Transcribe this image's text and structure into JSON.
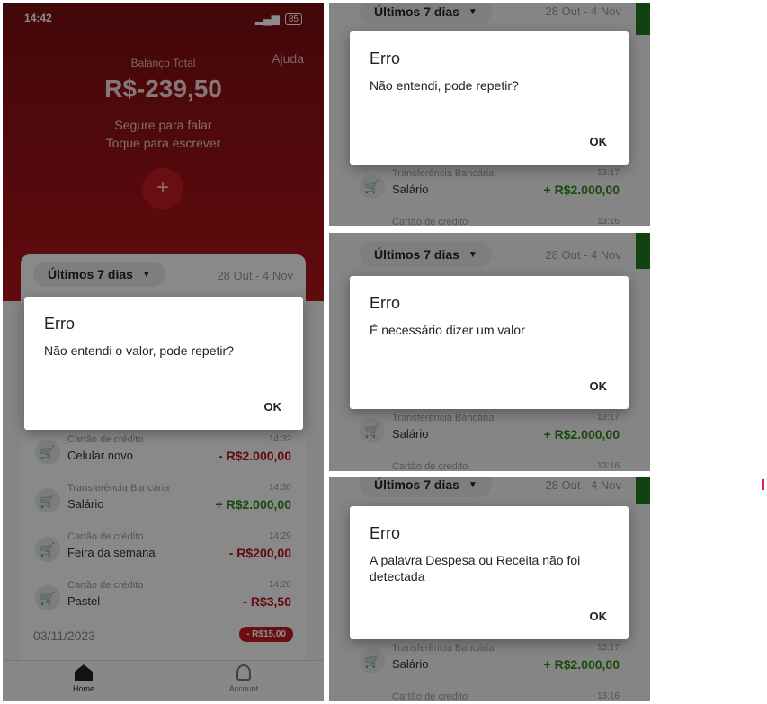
{
  "main": {
    "status_time": "14:42",
    "status_right": "85",
    "help": "Ajuda",
    "balance_label": "Balanço Total",
    "balance_value": "R$-239,50",
    "hint_line1": "Segure para falar",
    "hint_line2": "Toque para escrever",
    "add_symbol": "+",
    "period": "Últimos 7 dias",
    "date_range": "28 Out - 4 Nov",
    "dialog": {
      "title": "Erro",
      "message": "Não entendi o valor, pode repetir?",
      "ok": "OK"
    },
    "transactions": [
      {
        "sub": "Cartão de crédito",
        "name": "Celular novo",
        "time": "14:32",
        "value": "- R$2.000,00",
        "kind": "neg"
      },
      {
        "sub": "Transferência Bancária",
        "name": "Salário",
        "time": "14:30",
        "value": "+ R$2.000,00",
        "kind": "pos"
      },
      {
        "sub": "Cartão de crédito",
        "name": "Feira da semana",
        "time": "14:29",
        "value": "- R$200,00",
        "kind": "neg"
      },
      {
        "sub": "Cartão de crédito",
        "name": "Pastel",
        "time": "14:28",
        "value": "- R$3,50",
        "kind": "neg"
      }
    ],
    "day_date": "03/11/2023",
    "day_total": "- R$15,00",
    "nav": {
      "home": "Home",
      "account": "Account"
    }
  },
  "panels": [
    {
      "period": "Últimos 7 dias",
      "date_range": "28 Out - 4 Nov",
      "dialog": {
        "title": "Erro",
        "message": "Não entendi, pode repetir?",
        "ok": "OK"
      },
      "tx1": {
        "sub": "Transferência Bancária",
        "name": "Salário",
        "time": "13:17",
        "value": "+ R$2.000,00"
      },
      "tx2": {
        "sub": "Cartão de crédito",
        "time": "13:16"
      }
    },
    {
      "period": "Últimos 7 dias",
      "date_range": "28 Out - 4 Nov",
      "dialog": {
        "title": "Erro",
        "message": "É necessário dizer um valor",
        "ok": "OK"
      },
      "tx1": {
        "sub": "Transferência Bancária",
        "name": "Salário",
        "time": "13:17",
        "value": "+ R$2.000,00"
      },
      "tx2": {
        "sub": "Cartão de crédito",
        "time": "13:16"
      }
    },
    {
      "period": "Últimos 7 dias",
      "date_range": "28 Out - 4 Nov",
      "dialog": {
        "title": "Erro",
        "message": "A palavra Despesa ou Receita não foi detectada",
        "ok": "OK"
      },
      "tx1": {
        "sub": "Transferência Bancária",
        "name": "Salário",
        "time": "13:17",
        "value": "+ R$2.000,00"
      },
      "tx2": {
        "sub": "Cartão de crédito",
        "time": "13:16"
      }
    }
  ],
  "colors": {
    "brand_red": "#b0141a",
    "positive": "#2d8a16",
    "negative": "#b3131a",
    "accent_green": "#1f7a22",
    "marker": "#e0187a"
  }
}
